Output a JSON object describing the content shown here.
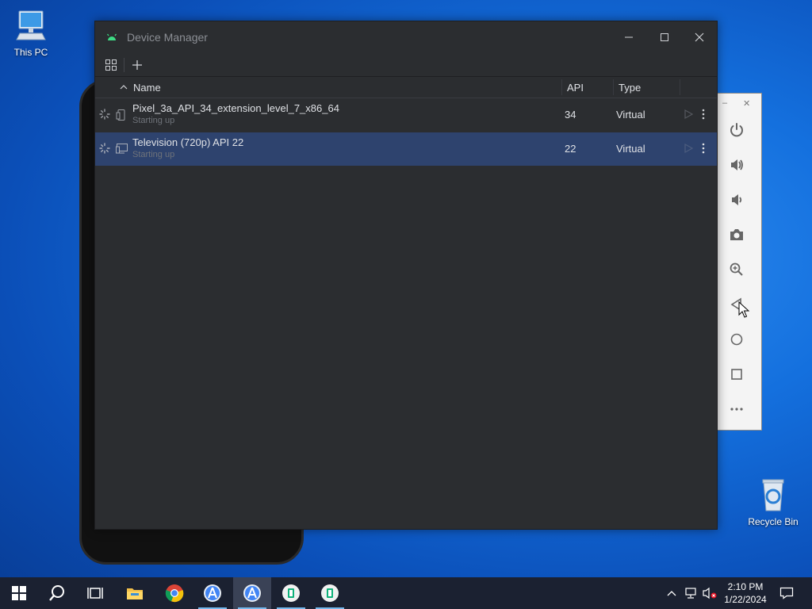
{
  "desktop": {
    "this_pc_label": "This PC",
    "recycle_bin_label": "Recycle Bin"
  },
  "window": {
    "title": "Device Manager",
    "controls": [
      "minimize",
      "maximize",
      "close"
    ]
  },
  "toolbar": {
    "icons": [
      "device-grid-icon",
      "add-icon"
    ]
  },
  "table": {
    "columns": {
      "name": "Name",
      "api": "API",
      "type": "Type"
    },
    "rows": [
      {
        "name": "Pixel_3a_API_34_extension_level_7_x86_64",
        "status": "Starting up",
        "api": "34",
        "type": "Virtual",
        "device": "phone",
        "selected": false
      },
      {
        "name": "Television (720p) API 22",
        "status": "Starting up",
        "api": "22",
        "type": "Virtual",
        "device": "tv",
        "selected": true
      }
    ]
  },
  "emulator_toolbar": {
    "buttons": [
      "power-icon",
      "volume-up-icon",
      "volume-down-icon",
      "camera-icon",
      "zoom-in-icon",
      "back-icon",
      "home-icon",
      "overview-icon",
      "more-icon"
    ]
  },
  "taskbar": {
    "items": [
      "start-icon",
      "search-icon",
      "task-view-icon",
      "file-explorer-icon",
      "chrome-icon",
      "android-studio-icon",
      "android-studio-icon",
      "jetbrains-icon",
      "jetbrains-icon"
    ],
    "time": "2:10 PM",
    "date": "1/22/2024"
  },
  "colors": {
    "window_bg": "#2b2d30",
    "selected_row": "#2e436e",
    "taskbar_bg": "#1b2131"
  }
}
